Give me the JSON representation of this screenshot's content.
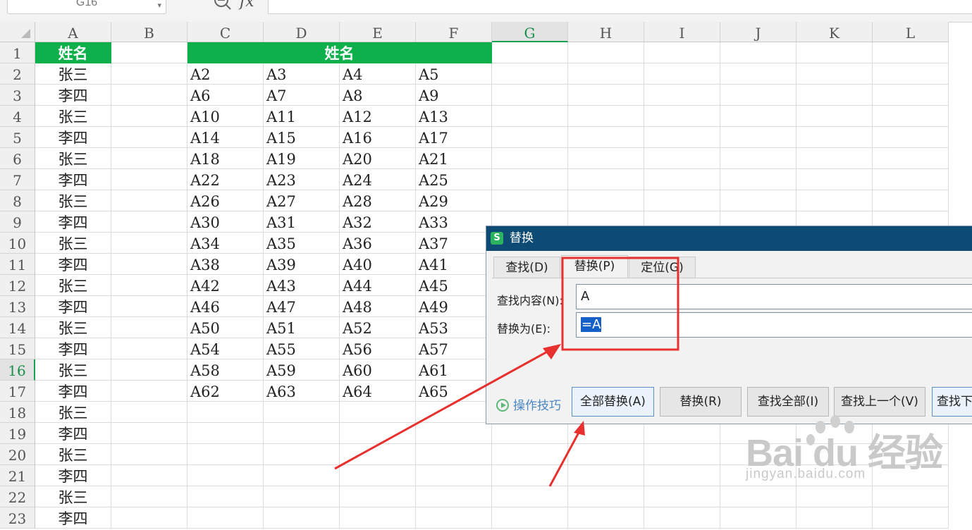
{
  "formula_bar": {
    "name_box": "G16",
    "fx_label": "fx"
  },
  "columns": [
    "A",
    "B",
    "C",
    "D",
    "E",
    "F",
    "G",
    "H",
    "I",
    "J",
    "K",
    "L"
  ],
  "rows": [
    "1",
    "2",
    "3",
    "4",
    "5",
    "6",
    "7",
    "8",
    "9",
    "10",
    "11",
    "12",
    "13",
    "14",
    "15",
    "16",
    "17",
    "18",
    "19",
    "20",
    "21",
    "22",
    "23"
  ],
  "sheet": {
    "a1_header": "姓名",
    "c1_header": "姓名",
    "col_a": [
      "张三",
      "李四",
      "张三",
      "李四",
      "张三",
      "李四",
      "张三",
      "李四",
      "张三",
      "李四",
      "张三",
      "李四",
      "张三",
      "李四",
      "张三",
      "李四",
      "张三",
      "李四",
      "张三",
      "李四",
      "张三",
      "李四"
    ],
    "grid_cf": [
      [
        "A2",
        "A3",
        "A4",
        "A5"
      ],
      [
        "A6",
        "A7",
        "A8",
        "A9"
      ],
      [
        "A10",
        "A11",
        "A12",
        "A13"
      ],
      [
        "A14",
        "A15",
        "A16",
        "A17"
      ],
      [
        "A18",
        "A19",
        "A20",
        "A21"
      ],
      [
        "A22",
        "A23",
        "A24",
        "A25"
      ],
      [
        "A26",
        "A27",
        "A28",
        "A29"
      ],
      [
        "A30",
        "A31",
        "A32",
        "A33"
      ],
      [
        "A34",
        "A35",
        "A36",
        "A37"
      ],
      [
        "A38",
        "A39",
        "A40",
        "A41"
      ],
      [
        "A42",
        "A43",
        "A44",
        "A45"
      ],
      [
        "A46",
        "A47",
        "A48",
        "A49"
      ],
      [
        "A50",
        "A51",
        "A52",
        "A53"
      ],
      [
        "A54",
        "A55",
        "A56",
        "A57"
      ],
      [
        "A58",
        "A59",
        "A60",
        "A61"
      ],
      [
        "A62",
        "A63",
        "A64",
        "A65"
      ]
    ]
  },
  "dialog": {
    "logo": "S",
    "title": "替换",
    "tabs": [
      "查找(D)",
      "替换(P)",
      "定位(G)"
    ],
    "find_label": "查找内容(N):",
    "find_value": "A",
    "replace_label": "替换为(E):",
    "replace_value": "=A",
    "tips_label": "操作技巧",
    "buttons": [
      "全部替换(A)",
      "替换(R)",
      "查找全部(I)",
      "查找上一个(V)",
      "查找下"
    ]
  },
  "watermark": {
    "brand": "Bai du 经验",
    "url": "jingyan.baidu.com"
  },
  "colors": {
    "header_green": "#0db04b",
    "dialog_title": "#0d4a74",
    "annotation_red": "#e8312f",
    "selection_blue": "#1560c8"
  }
}
